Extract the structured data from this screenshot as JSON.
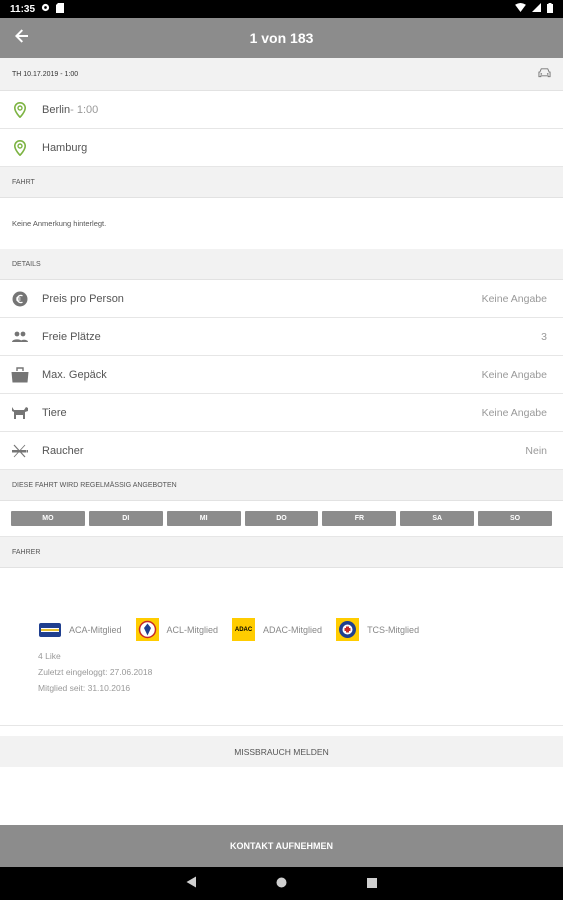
{
  "status_bar": {
    "time": "11:35"
  },
  "app_bar": {
    "title": "1 von 183"
  },
  "trip": {
    "date_line": "TH 10.17.2019 - 1:00",
    "from": {
      "city": "Berlin",
      "time": " - 1:00"
    },
    "to": {
      "city": "Hamburg"
    }
  },
  "sections": {
    "fahrt": "FAHRT",
    "details": "DETAILS",
    "regular": "DIESE FAHRT WIRD REGELMÄSSIG ANGEBOTEN",
    "fahrer": "FAHRER"
  },
  "note": "Keine Anmerkung hinterlegt.",
  "details": [
    {
      "icon": "euro-icon",
      "label": "Preis pro Person",
      "value": "Keine Angabe"
    },
    {
      "icon": "people-icon",
      "label": "Freie Plätze",
      "value": "3"
    },
    {
      "icon": "luggage-icon",
      "label": "Max. Gepäck",
      "value": "Keine Angabe"
    },
    {
      "icon": "pet-icon",
      "label": "Tiere",
      "value": "Keine Angabe"
    },
    {
      "icon": "smoking-icon",
      "label": "Raucher",
      "value": "Nein"
    }
  ],
  "days": [
    "MO",
    "DI",
    "MI",
    "DO",
    "FR",
    "SA",
    "SO"
  ],
  "driver": {
    "clubs": [
      {
        "label": "ACA-Mitglied",
        "logo": "aca-logo",
        "logo_text": ""
      },
      {
        "label": "ACL-Mitglied",
        "logo": "acl-logo",
        "logo_text": ""
      },
      {
        "label": "ADAC-Mitglied",
        "logo": "adac-logo",
        "logo_text": "ADAC"
      },
      {
        "label": "TCS-Mitglied",
        "logo": "tcs-logo",
        "logo_text": ""
      }
    ],
    "likes": "4 Like",
    "last_login": "Zuletzt eingeloggt: 27.06.2018",
    "member_since": "Mitglied seit: 31.10.2016"
  },
  "actions": {
    "report": "MISSBRAUCH MELDEN",
    "contact": "KONTAKT AUFNEHMEN"
  },
  "colors": {
    "app_bar": "#8c8c8c",
    "pin_green": "#7cb342",
    "icon_gray": "#757575",
    "adac_yellow": "#ffcc00"
  }
}
